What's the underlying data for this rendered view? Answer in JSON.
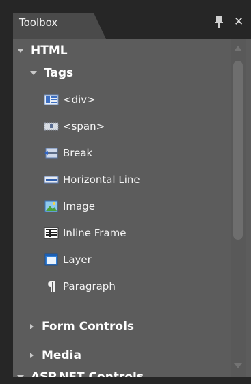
{
  "panel": {
    "title": "Toolbox"
  },
  "sections": [
    {
      "label": "HTML",
      "expanded": true
    },
    {
      "label": "Tags",
      "expanded": true
    },
    {
      "label": "Form Controls",
      "expanded": false
    },
    {
      "label": "Media",
      "expanded": false
    },
    {
      "label": "ASP.NET Controls",
      "expanded": true
    }
  ],
  "items": [
    {
      "label": "<div>",
      "icon": "div-icon"
    },
    {
      "label": "<span>",
      "icon": "span-icon"
    },
    {
      "label": "Break",
      "icon": "break-icon"
    },
    {
      "label": "Horizontal Line",
      "icon": "horizontal-line-icon"
    },
    {
      "label": "Image",
      "icon": "image-icon"
    },
    {
      "label": "Inline Frame",
      "icon": "inline-frame-icon"
    },
    {
      "label": "Layer",
      "icon": "layer-icon"
    },
    {
      "label": "Paragraph",
      "icon": "paragraph-icon"
    }
  ],
  "colors": {
    "panel_bg": "#5c5c5c",
    "tab_bg": "#4a4a4a",
    "frame_bg": "#262626",
    "text": "#ffffff"
  }
}
